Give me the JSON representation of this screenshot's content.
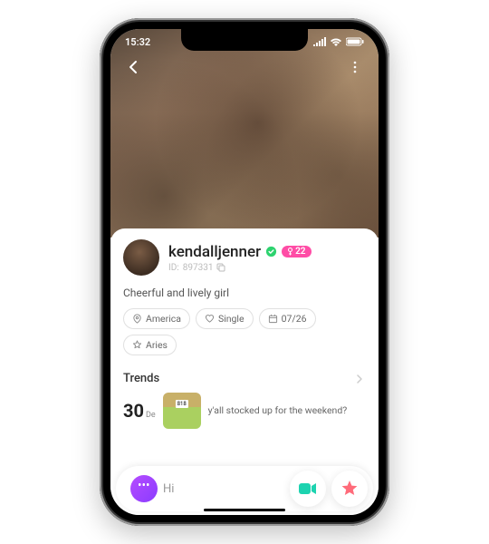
{
  "status": {
    "time": "15:32"
  },
  "profile": {
    "username": "kendalljenner",
    "age_badge": "22",
    "id_label": "ID:",
    "id_value": "897331",
    "bio": "Cheerful and lively girl"
  },
  "tags": {
    "location": "America",
    "relationship": "Single",
    "birthday": "07/26",
    "zodiac": "Aries"
  },
  "trends": {
    "title": "Trends",
    "day": "30",
    "month": "De",
    "post_text": "y'all stocked up for the weekend?"
  },
  "actions": {
    "hi_label": "Hi"
  }
}
